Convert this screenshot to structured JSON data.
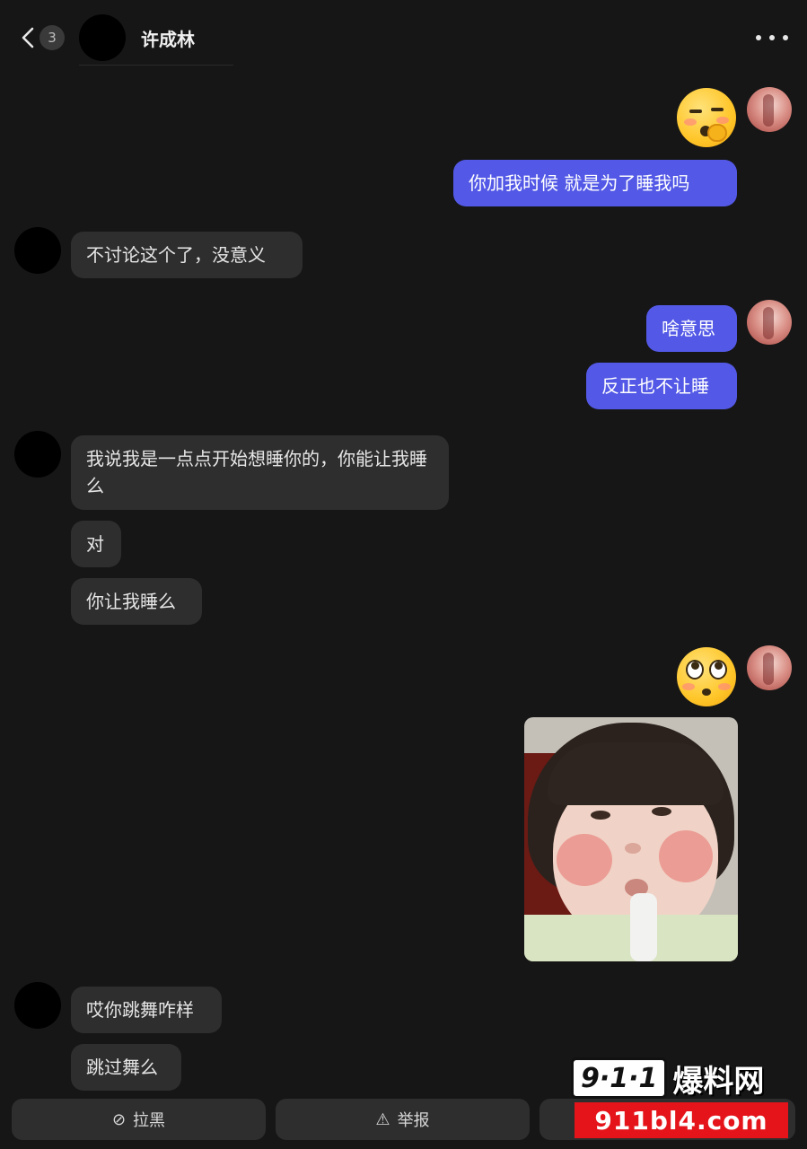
{
  "header": {
    "back_badge": "3",
    "title": "许成林"
  },
  "messages": {
    "out_1": "你加我时候  就是为了睡我吗",
    "in_1": "不讨论这个了，没意义",
    "out_2": "啥意思",
    "out_3": "反正也不让睡",
    "in_2": "我说我是一点点开始想睡你的，你能让我睡么",
    "in_3": "对",
    "in_4": "你让我睡么",
    "in_5": "哎你跳舞咋样",
    "in_6": "跳过舞么"
  },
  "footer": {
    "block_label": "拉黑",
    "block_icon": "⊘",
    "report_label": "举报",
    "report_icon": "⚠"
  },
  "watermark": {
    "logo_num": "9·1·1",
    "logo_cn": "爆料网",
    "url": "911bl4.com"
  },
  "colors": {
    "background": "#161616",
    "outgoing_bubble": "#5359e6",
    "incoming_bubble": "#2e2e2e",
    "watermark_red": "#e4141a"
  }
}
